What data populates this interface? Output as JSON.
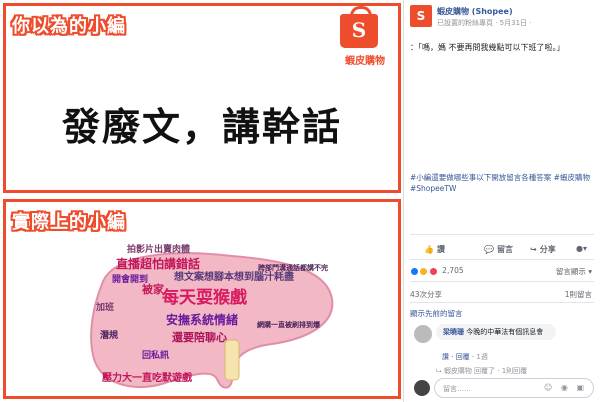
{
  "image": {
    "top_title": "你以為的小編",
    "brand_letter": "S",
    "brand_name": "蝦皮購物",
    "big_text": "發廢文，講幹話",
    "bottom_title": "實際上的小編",
    "word_cloud": [
      "拍影片出賣肉體",
      "直播超怕講錯話",
      "想文案想腳本想到腦汁耗盡",
      "開會開到",
      "跨部門溝通話都講不完",
      "每天耍猴戲",
      "安撫系統情緒",
      "還要陪聊心",
      "網購一直被刷排到爆",
      "壓力大一直吃默遊戲",
      "回私訊",
      "潛規",
      "被家",
      "加班"
    ]
  },
  "post": {
    "page_name": "蝦皮購物 (Shopee)",
    "meta": "已設置的粉絲專頁 · 5月31日 ·",
    "text": "：「嗎，媽 不要再問我幾點可以下班了啦。」",
    "hashtags": "#小編還要做哪些事以下開放留言各種答案 #蝦皮購物 #ShopeeTW",
    "actions": {
      "like": "讚",
      "comment": "留言",
      "share": "分享"
    },
    "reactions": {
      "count": "2,705",
      "colors": [
        "#1877f2",
        "#f7b125",
        "#f33e58"
      ]
    },
    "sort_label": "留言顯示 ▾",
    "shares": "43次分享",
    "comments_count": "1則留言",
    "prev_comments": "顯示先前的留言",
    "comment": {
      "author": "梁曉珊",
      "text": "今晚的中華法有個訊息會",
      "like_label": "讚",
      "reply_label": "回覆",
      "reply_count": "1週"
    },
    "reply_hint": "⮡ 蝦皮購物 回覆了 · 1則回覆",
    "input_placeholder": "留言……"
  }
}
